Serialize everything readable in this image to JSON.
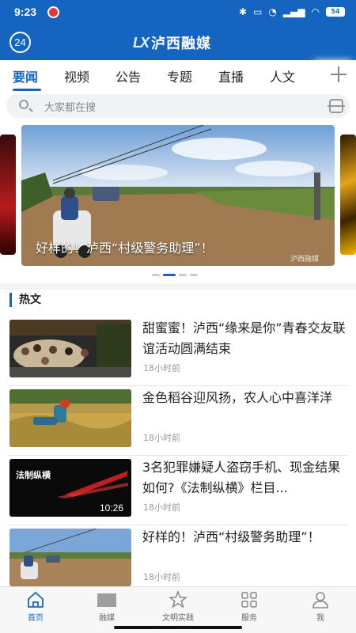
{
  "status_bar": {
    "time": "9:23",
    "battery": "54"
  },
  "header": {
    "badge": "24",
    "logo_mark": "LX",
    "app_name": "泸西融媒"
  },
  "tabs": [
    {
      "label": "要闻",
      "active": true
    },
    {
      "label": "视频"
    },
    {
      "label": "公告"
    },
    {
      "label": "专题"
    },
    {
      "label": "直播"
    },
    {
      "label": "人文"
    }
  ],
  "search": {
    "placeholder": "大家都在搜"
  },
  "banner": {
    "caption": "好样的！泸西“村级警务助理”！",
    "watermark": "泸西融媒",
    "slide_count": 4,
    "active_slide": 2
  },
  "hot": {
    "heading": "热文",
    "articles": [
      {
        "title": "甜蜜蜜！泸西“缘来是你”青春交友联谊活动圆满结束",
        "time": "18小时前"
      },
      {
        "title": "金色稻谷迎风扬，农人心中喜洋洋",
        "time": "18小时前"
      },
      {
        "title": "3名犯罪嫌疑人盗窃手机、现金结果如何?《法制纵横》栏目...",
        "time": "18小时前",
        "duration": "10:26",
        "thumb_text": "法制纵横"
      },
      {
        "title": "好样的！泸西“村级警务助理”！",
        "time": "18小时前"
      }
    ]
  },
  "bottom_nav": [
    {
      "label": "首页",
      "icon": "home-icon",
      "active": true
    },
    {
      "label": "融媒",
      "icon": "media-icon"
    },
    {
      "label": "文明实践",
      "icon": "star-icon"
    },
    {
      "label": "服务",
      "icon": "grid-icon"
    },
    {
      "label": "我",
      "icon": "person-icon"
    }
  ],
  "colors": {
    "brand": "#1565c0",
    "text": "#222222",
    "muted": "#999999"
  }
}
